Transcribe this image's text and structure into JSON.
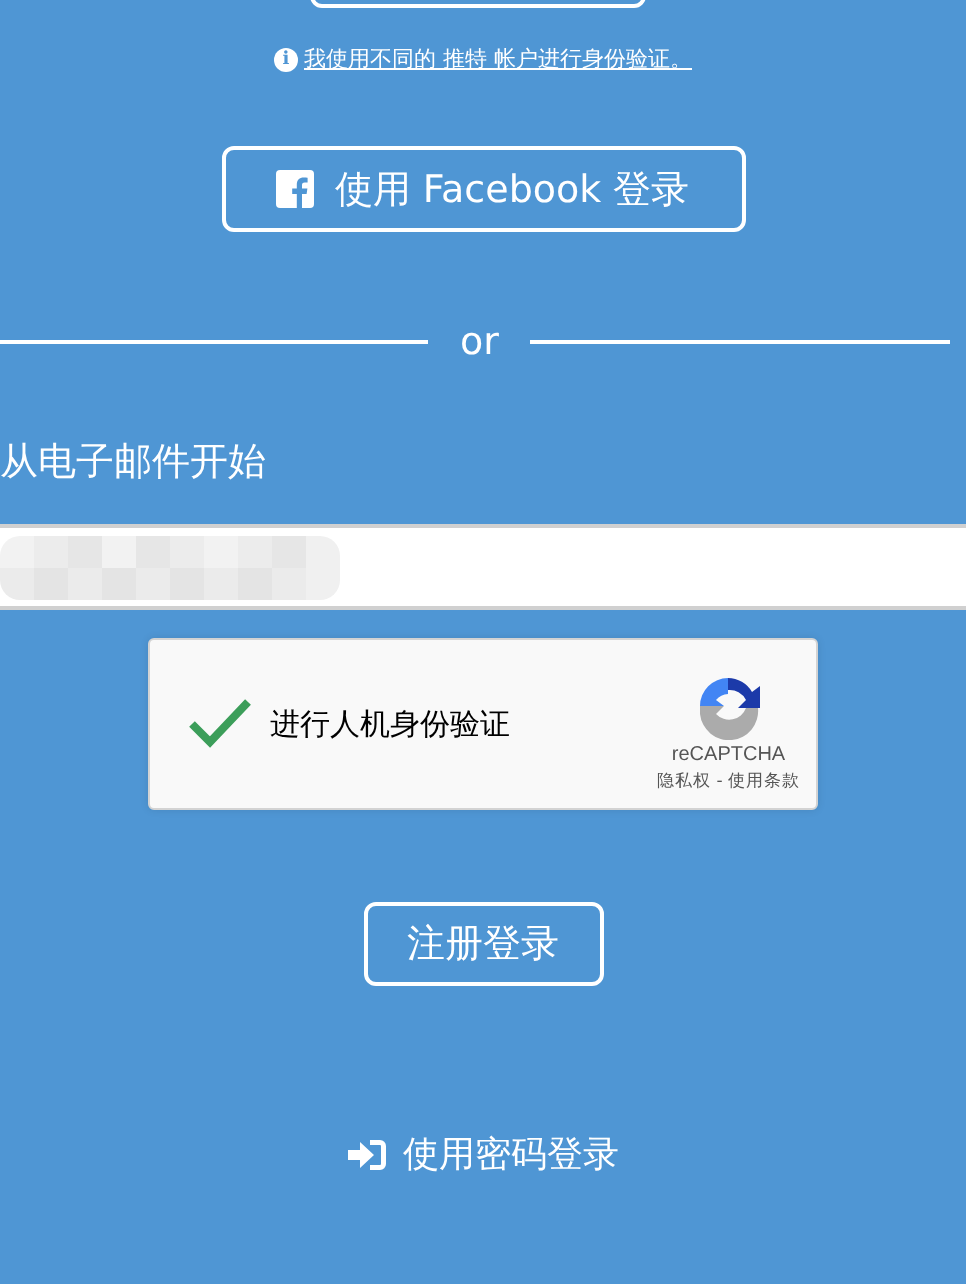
{
  "alt_account_link": {
    "icon": "ℹ",
    "text": "我使用不同的 推特 帐户进行身份验证。"
  },
  "facebook_button": {
    "label": "使用 Facebook 登录"
  },
  "divider": {
    "text": "or"
  },
  "email": {
    "label": "从电子邮件开始",
    "value_blurred": true
  },
  "captcha": {
    "checked": true,
    "label": "进行人机身份验证",
    "brand": "reCAPTCHA",
    "links": "隐私权 - 使用条款"
  },
  "register_button": {
    "label": "注册登录"
  },
  "password_login": {
    "label": "使用密码登录"
  }
}
